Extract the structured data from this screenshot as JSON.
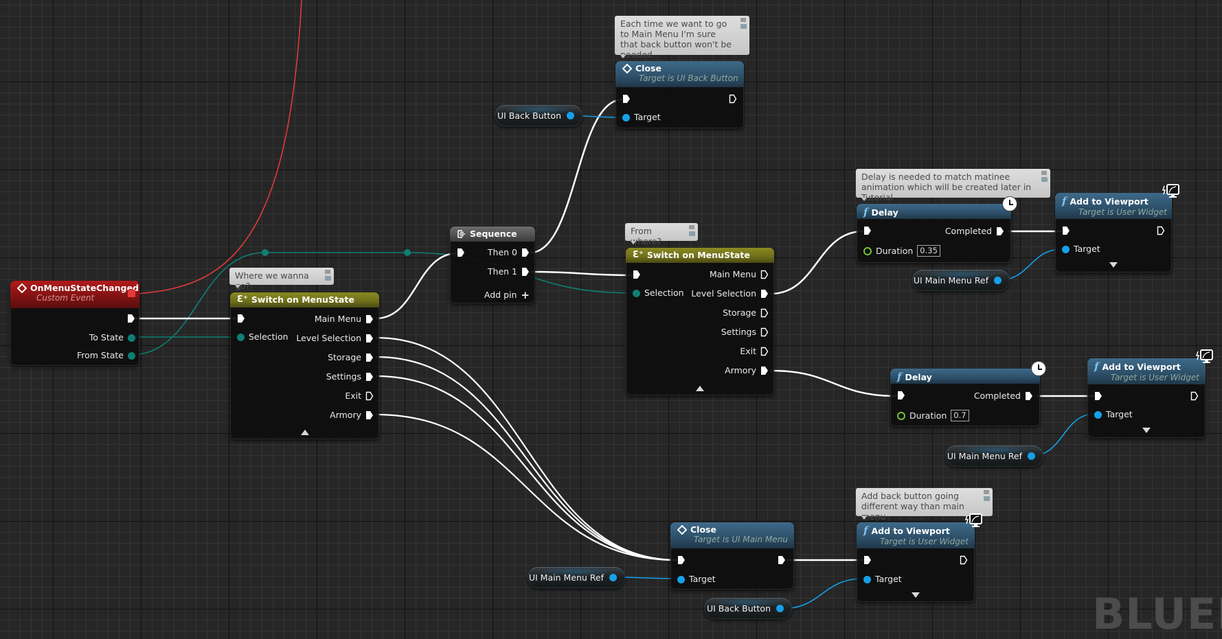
{
  "app": {
    "watermark": "BLUEPRINT"
  },
  "colors": {
    "exec_wire": "#ffffff",
    "enum_wire": "#0f7e75",
    "object_wire": "#14a1ea",
    "delegate_wire": "#e03a3a",
    "event_header": "#9a1717",
    "switch_header": "#7a7a1e",
    "function_header": "#2d4f68",
    "float_pin": "#72c535"
  },
  "comments": {
    "close_back": "Each time we want to go to Main Menu I'm sure that back button won't be needed.",
    "switch_to": "Where we wanna go?",
    "switch_from": "From where?",
    "delay": "Delay is needed to match matinee animation which will be created later in Tutorial",
    "add_back": "Add back button going different way than main menu"
  },
  "nodes": {
    "event": {
      "title": "OnMenuStateChanged",
      "subtitle": "Custom Event",
      "pins": {
        "to_state": "To State",
        "from_state": "From State"
      }
    },
    "switch_to": {
      "title": "Switch on MenuState",
      "selection": "Selection",
      "outputs": [
        "Main Menu",
        "Level Selection",
        "Storage",
        "Settings",
        "Exit",
        "Armory"
      ]
    },
    "sequence": {
      "title": "Sequence",
      "outputs": [
        "Then 0",
        "Then 1"
      ],
      "add_pin": "Add pin"
    },
    "close_back": {
      "title": "Close",
      "subtitle": "Target is UI Back Button",
      "target": "Target"
    },
    "switch_from": {
      "title": "Switch on MenuState",
      "selection": "Selection",
      "outputs": [
        "Main Menu",
        "Level Selection",
        "Storage",
        "Settings",
        "Exit",
        "Armory"
      ]
    },
    "delay1": {
      "title": "Delay",
      "completed": "Completed",
      "duration_label": "Duration",
      "duration": "0.35"
    },
    "delay2": {
      "title": "Delay",
      "completed": "Completed",
      "duration_label": "Duration",
      "duration": "0.7"
    },
    "add_vp1": {
      "title": "Add to Viewport",
      "subtitle": "Target is User Widget",
      "target": "Target"
    },
    "add_vp2": {
      "title": "Add to Viewport",
      "subtitle": "Target is User Widget",
      "target": "Target"
    },
    "add_vp3": {
      "title": "Add to Viewport",
      "subtitle": "Target is User Widget",
      "target": "Target"
    },
    "close_menu": {
      "title": "Close",
      "subtitle": "Target is UI Main Menu",
      "target": "Target"
    }
  },
  "variables": {
    "back_button_1": "UI Back Button",
    "main_menu_ref_1": "UI Main Menu Ref",
    "main_menu_ref_2": "UI Main Menu Ref",
    "main_menu_ref_3": "UI Main Menu Ref",
    "back_button_2": "UI Back Button"
  }
}
